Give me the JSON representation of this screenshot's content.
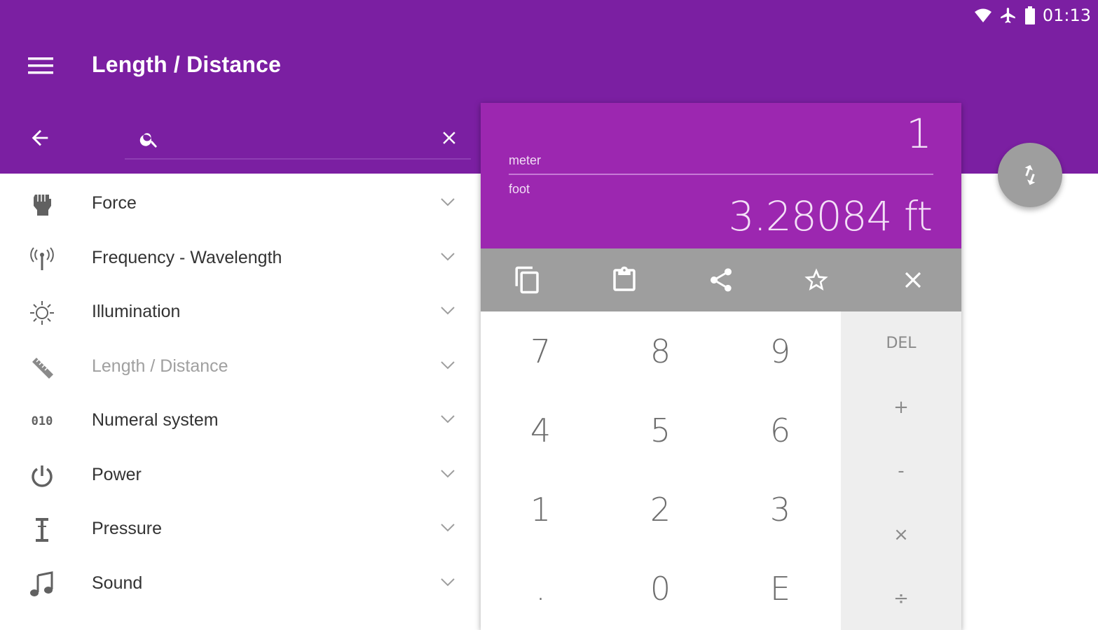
{
  "status_bar": {
    "time": "01:13",
    "icons": [
      "wifi-icon",
      "airplane-icon",
      "battery-icon"
    ]
  },
  "app_bar": {
    "title": "Length / Distance",
    "menu_icon": "menu-icon"
  },
  "search": {
    "placeholder": "",
    "value": "",
    "search_icon": "search-icon",
    "back_icon": "arrow-left-icon",
    "clear_icon": "close-icon"
  },
  "categories": [
    {
      "label": "Force",
      "icon": "fist-icon"
    },
    {
      "label": "Frequency - Wavelength",
      "icon": "antenna-icon"
    },
    {
      "label": "Illumination",
      "icon": "sun-icon"
    },
    {
      "label": "Length / Distance",
      "icon": "ruler-icon",
      "selected": true
    },
    {
      "label": "Numeral system",
      "icon": "binary-icon",
      "icon_text": "010"
    },
    {
      "label": "Power",
      "icon": "power-icon"
    },
    {
      "label": "Pressure",
      "icon": "pressure-icon"
    },
    {
      "label": "Sound",
      "icon": "music-note-icon"
    }
  ],
  "converter": {
    "input_value": "1",
    "from_unit": "meter",
    "to_unit": "foot",
    "result": "3.28084 ft",
    "actions": [
      "copy-icon",
      "clipboard-icon",
      "share-icon",
      "star-icon",
      "close-icon"
    ]
  },
  "keypad": {
    "digits": [
      "7",
      "8",
      "9",
      "4",
      "5",
      "6",
      "1",
      "2",
      "3",
      ".",
      "0",
      "E"
    ],
    "operators": [
      "DEL",
      "+",
      "-",
      "×",
      "÷"
    ]
  },
  "colors": {
    "primary": "#7b1fa2",
    "accent": "#9c27b0",
    "action_bar": "#9e9e9e",
    "op_panel": "#eeeeee"
  }
}
